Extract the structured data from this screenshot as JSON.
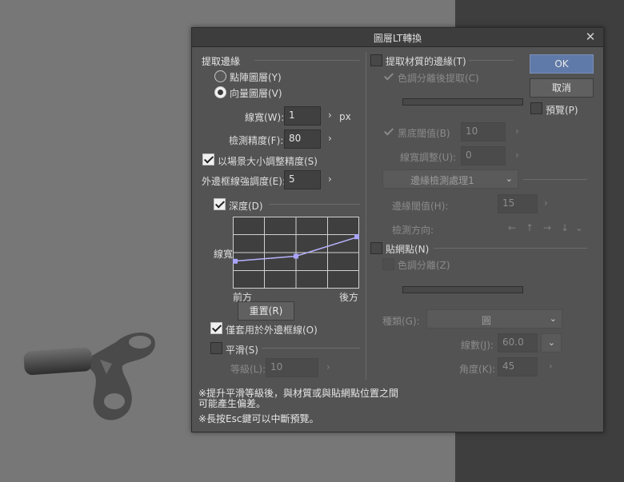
{
  "dialog": {
    "title": "圖層LT轉換",
    "close_glyph": "✕"
  },
  "left": {
    "extract_edge_label": "提取邊緣",
    "raster_layer": "點陣圖層(Y)",
    "vector_layer": "向量圖層(V)",
    "line_width_label": "線寬(W):",
    "line_width_value": "1",
    "line_width_unit": "px",
    "detect_precision_label": "檢測精度(F):",
    "detect_precision_value": "80",
    "adjust_by_size_label": "以場景大小調整精度(S)",
    "outer_line_label": "外邊框線強調度(E):",
    "outer_line_value": "5",
    "depth_label": "深度(D)",
    "graph_ylabel": "線寬",
    "graph_front": "前方",
    "graph_back": "後方",
    "reset_label": "重置(R)",
    "apply_outer_only_label": "僅套用於外邊框線(O)",
    "smooth_label": "平滑(S)",
    "level_label": "等級(L):",
    "level_value": "10"
  },
  "right": {
    "extract_texture_label": "提取材質的邊緣(T)",
    "extract_after_tone_label": "色調分離後提取(C)",
    "black_threshold_label": "黑底閾值(B)",
    "black_threshold_value": "10",
    "line_adjust_label": "線寬調整(U):",
    "line_adjust_value": "0",
    "edge_process_option": "邊緣檢測處理1",
    "edge_threshold_label": "邊緣閾值(H):",
    "edge_threshold_value": "15",
    "detect_dir_label": "檢測方向:",
    "halftone_label": "貼網點(N)",
    "tone_sep_label": "色調分離(Z)",
    "type_label": "種類(G):",
    "type_value": "圓",
    "lines_label": "線數(J):",
    "lines_value": "60.0",
    "angle_label": "角度(K):",
    "angle_value": "45"
  },
  "buttons": {
    "ok": "OK",
    "cancel": "取消",
    "preview": "預覽(P)"
  },
  "notes": {
    "note1_line1": "※提升平滑等級後，與材質或與貼網點位置之間",
    "note1_line2": "可能產生偏差。",
    "note2": "※長按Esc鍵可以中斷預覽。"
  },
  "icons": {
    "arrow_right": "›",
    "chevron_down": "⌄",
    "dir_left": "←",
    "dir_up": "↑",
    "dir_right": "→",
    "dir_down": "↓"
  },
  "graph": {
    "curve_points": [
      [
        0,
        0.38
      ],
      [
        0.5,
        0.45
      ],
      [
        1,
        0.72
      ]
    ]
  },
  "colors": {
    "accent": "#5f7aa8",
    "curve": "#b7b3ff"
  }
}
